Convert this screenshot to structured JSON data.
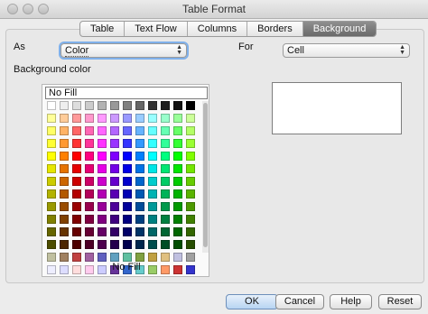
{
  "window": {
    "title": "Table Format"
  },
  "tabs": [
    "Table",
    "Text Flow",
    "Columns",
    "Borders",
    "Background"
  ],
  "active_tab": "Background",
  "as_field": {
    "label": "As",
    "value": "Color"
  },
  "for_field": {
    "label": "For",
    "value": "Cell"
  },
  "section": {
    "label": "Background color"
  },
  "color_picker": {
    "name_field": "No Fill",
    "caption": "No Fill",
    "palette": [
      [
        "#ffffff",
        "#eeeeee",
        "#dddddd",
        "#cccccc",
        "#b3b3b3",
        "#999999",
        "#808080",
        "#666666",
        "#333333",
        "#1c1c1c",
        "#111111",
        "#000000"
      ],
      [
        "#ffff99",
        "#ffcc99",
        "#ff9999",
        "#ff99cc",
        "#ff99ff",
        "#cc99ff",
        "#9999ff",
        "#99ccff",
        "#99ffff",
        "#99ffcc",
        "#99ff99",
        "#ccff99"
      ],
      [
        "#ffff66",
        "#ffb366",
        "#ff6666",
        "#ff66b3",
        "#ff66ff",
        "#b366ff",
        "#6666ff",
        "#66b3ff",
        "#66ffff",
        "#66ffb3",
        "#66ff66",
        "#b3ff66"
      ],
      [
        "#ffff33",
        "#ff9933",
        "#ff3333",
        "#ff3399",
        "#ff33ff",
        "#9933ff",
        "#3333ff",
        "#3399ff",
        "#33ffff",
        "#33ff99",
        "#33ff33",
        "#99ff33"
      ],
      [
        "#ffff00",
        "#ff8000",
        "#ff0000",
        "#ff0080",
        "#ff00ff",
        "#8000ff",
        "#0000ff",
        "#0080ff",
        "#00ffff",
        "#00ff80",
        "#00ff00",
        "#80ff00"
      ],
      [
        "#e6e600",
        "#e67300",
        "#e60000",
        "#e60073",
        "#e600e6",
        "#7300e6",
        "#0000e6",
        "#0073e6",
        "#00e6e6",
        "#00e673",
        "#00e600",
        "#73e600"
      ],
      [
        "#cccc00",
        "#cc6600",
        "#cc0000",
        "#cc0066",
        "#cc00cc",
        "#6600cc",
        "#0000cc",
        "#0066cc",
        "#00cccc",
        "#00cc66",
        "#00cc00",
        "#66cc00"
      ],
      [
        "#b3b300",
        "#b35900",
        "#b30000",
        "#b30059",
        "#b300b3",
        "#5900b3",
        "#0000b3",
        "#0059b3",
        "#00b3b3",
        "#00b359",
        "#00b300",
        "#59b300"
      ],
      [
        "#999900",
        "#994c00",
        "#990000",
        "#99004c",
        "#990099",
        "#4c0099",
        "#000099",
        "#004c99",
        "#009999",
        "#00994c",
        "#009900",
        "#4c9900"
      ],
      [
        "#808000",
        "#804000",
        "#800000",
        "#800040",
        "#800080",
        "#400080",
        "#000080",
        "#004080",
        "#008080",
        "#008040",
        "#008000",
        "#408000"
      ],
      [
        "#666600",
        "#663300",
        "#660000",
        "#660033",
        "#660066",
        "#330066",
        "#000066",
        "#003366",
        "#006666",
        "#006633",
        "#006600",
        "#336600"
      ],
      [
        "#4d4d00",
        "#4d2600",
        "#4d0000",
        "#4d0026",
        "#4d004d",
        "#26004d",
        "#00004d",
        "#00264d",
        "#004d4d",
        "#004d26",
        "#004d00",
        "#264d00"
      ],
      [
        "#c0c0a0",
        "#a08060",
        "#c04040",
        "#a060a0",
        "#6060c0",
        "#60a0c0",
        "#60c0a0",
        "#80a040",
        "#c0a040",
        "#e0c080",
        "#c0c0e0",
        "#a0a0a0"
      ],
      [
        "#eeeeff",
        "#ddddff",
        "#ffdddd",
        "#ffccee",
        "#ccccff",
        "#663399",
        "#3366cc",
        "#66cccc",
        "#99cc66",
        "#ff9966",
        "#cc3333",
        "#3333cc"
      ]
    ]
  },
  "buttons": {
    "ok": "OK",
    "cancel": "Cancel",
    "help": "Help",
    "reset": "Reset"
  }
}
